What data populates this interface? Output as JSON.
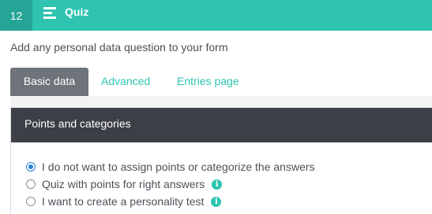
{
  "topbar": {
    "step_number": "12",
    "title": "Quiz",
    "icon": "list-lines-icon",
    "color": "#2ec4b0"
  },
  "subtitle": "Add any personal data question to your form",
  "tabs": [
    {
      "label": "Basic data",
      "active": true
    },
    {
      "label": "Advanced",
      "active": false
    },
    {
      "label": "Entries page",
      "active": false
    }
  ],
  "section": {
    "title": "Points and categories",
    "options": [
      {
        "label": "I do not want to assign points or categorize the answers",
        "selected": true,
        "info": false
      },
      {
        "label": "Quiz with points for right answers",
        "selected": false,
        "info": true
      },
      {
        "label": "I want to create a personality test",
        "selected": false,
        "info": true
      }
    ]
  },
  "info_icon_glyph": "i"
}
